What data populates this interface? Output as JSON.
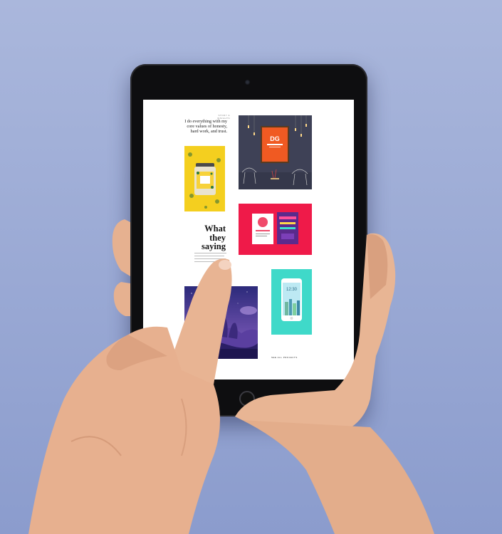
{
  "screen": {
    "caption_top": "STORY & INSIGHTS",
    "intro_text": "I do everything with my core values of honesty, hard work, and trust.",
    "heading": "What they saying",
    "footer_caption": "SEE ALL PROJECTS"
  },
  "cards": [
    {
      "name": "poster-mockup",
      "subject": "framed orange poster in dark room"
    },
    {
      "name": "jar-packaging",
      "subject": "yellow patterned jar label"
    },
    {
      "name": "event-flyers",
      "subject": "two flyers on red background"
    },
    {
      "name": "phone-app",
      "subject": "smartphone app on teal background"
    },
    {
      "name": "night-landscape",
      "subject": "purple night landscape illustration"
    }
  ],
  "colors": {
    "background": "#98a7d4",
    "tablet": "#0e0e10",
    "red_card": "#ef1a49",
    "yellow_card": "#f4cf1f",
    "teal_card": "#3ad8c8",
    "purple_card": "#3d2f8f"
  }
}
